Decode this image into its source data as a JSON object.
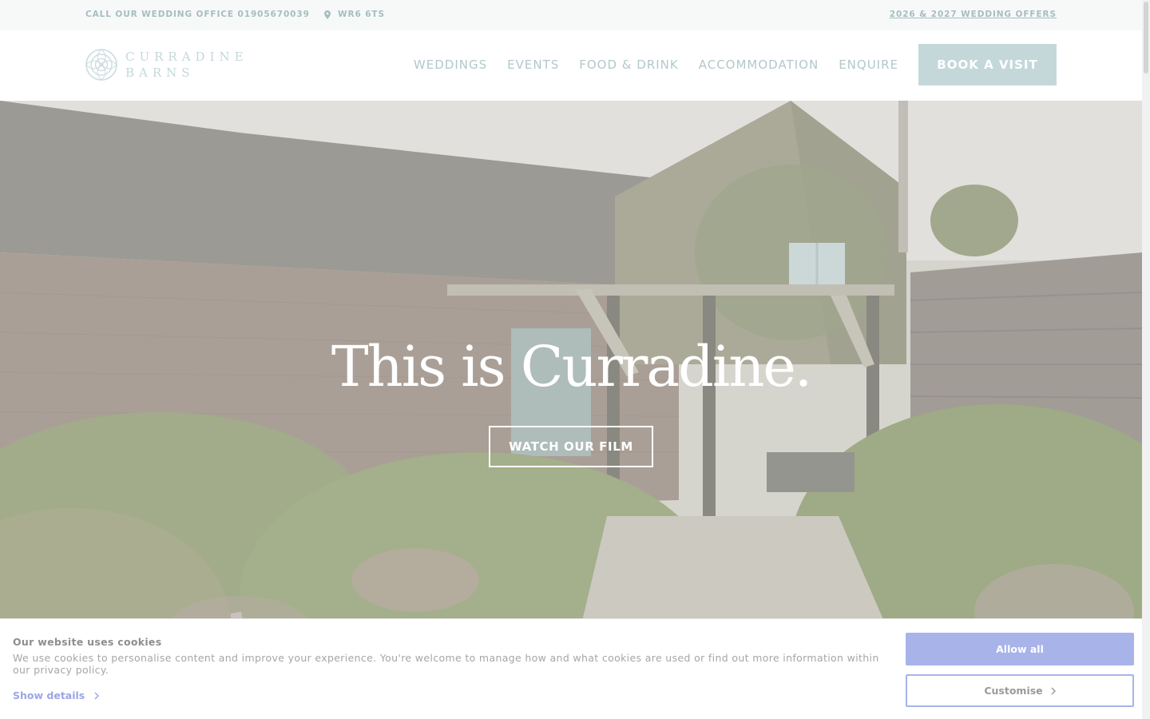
{
  "topbar": {
    "phone": "CALL OUR WEDDING OFFICE 01905670039",
    "postcode": "WR6 6TS",
    "offers": "2026 & 2027 WEDDING OFFERS",
    "location_icon": "map-pin-icon"
  },
  "header": {
    "logo_line1": "CURRADINE",
    "logo_line2": "BARNS",
    "logo_icon": "rose-logo-icon",
    "nav": [
      "WEDDINGS",
      "EVENTS",
      "FOOD & DRINK",
      "ACCOMMODATION",
      "ENQUIRE"
    ],
    "cta": "BOOK A VISIT"
  },
  "hero": {
    "title": "This is Curradine.",
    "button": "WATCH OUR FILM"
  },
  "cookie": {
    "title": "Our website uses cookies",
    "text": "We use cookies to personalise content and improve your experience. You're welcome to manage how and what cookies are used or find out more information within our privacy policy.",
    "details": "Show details",
    "allow": "Allow all",
    "customise": "Customise",
    "chevron_icon": "chevron-right-icon"
  },
  "colors": {
    "accent": "#c4d8da",
    "nav_text": "#b2c8cb",
    "cookie_accent": "#a8b3ea"
  }
}
